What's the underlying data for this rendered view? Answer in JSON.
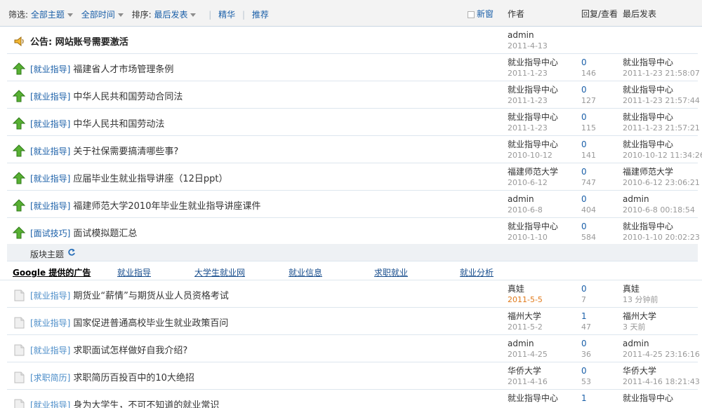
{
  "filters": {
    "filter_label": "筛选:",
    "all_topics": "全部主题",
    "all_time": "全部时间",
    "sort_label": "排序:",
    "sort_value": "最后发表",
    "digest": "精华",
    "recommend": "推荐",
    "new_window": "新窗"
  },
  "columns": {
    "author": "作者",
    "replies_views": "回复/查看",
    "last_post": "最后发表"
  },
  "announcement": {
    "title": "公告: 网站账号需要激活",
    "author": "admin",
    "date": "2011-4-13"
  },
  "sticky_rows": [
    {
      "cat": "[就业指导]",
      "subject": "福建省人才市场管理条例",
      "author": "就业指导中心",
      "date": "2011-1-23",
      "replies": "0",
      "views": "146",
      "last_user": "就业指导中心",
      "last_time": "2011-1-23 21:58:07"
    },
    {
      "cat": "[就业指导]",
      "subject": "中华人民共和国劳动合同法",
      "author": "就业指导中心",
      "date": "2011-1-23",
      "replies": "0",
      "views": "127",
      "last_user": "就业指导中心",
      "last_time": "2011-1-23 21:57:44"
    },
    {
      "cat": "[就业指导]",
      "subject": "中华人民共和国劳动法",
      "author": "就业指导中心",
      "date": "2011-1-23",
      "replies": "0",
      "views": "115",
      "last_user": "就业指导中心",
      "last_time": "2011-1-23 21:57:21"
    },
    {
      "cat": "[就业指导]",
      "subject": "关于社保需要搞清哪些事?",
      "author": "就业指导中心",
      "date": "2010-10-12",
      "replies": "0",
      "views": "141",
      "last_user": "就业指导中心",
      "last_time": "2010-10-12 11:34:26"
    },
    {
      "cat": "[就业指导]",
      "subject": "应届毕业生就业指导讲座（12日ppt）",
      "author": "福建师范大学",
      "date": "2010-6-12",
      "replies": "0",
      "views": "747",
      "last_user": "福建师范大学",
      "last_time": "2010-6-12 23:06:21"
    },
    {
      "cat": "[就业指导]",
      "subject": "福建师范大学2010年毕业生就业指导讲座课件",
      "author": "admin",
      "date": "2010-6-8",
      "replies": "0",
      "views": "404",
      "last_user": "admin",
      "last_time": "2010-6-8 00:18:54"
    },
    {
      "cat": "[面试技巧]",
      "subject": "面试模拟题汇总",
      "author": "就业指导中心",
      "date": "2010-1-10",
      "replies": "0",
      "views": "584",
      "last_user": "就业指导中心",
      "last_time": "2010-1-10 20:02:23"
    }
  ],
  "section": {
    "label": "版块主题"
  },
  "ads": {
    "google": "Google 提供的广告",
    "links": [
      "就业指导",
      "大学生就业网",
      "就业信息",
      "求职就业",
      "就业分析"
    ]
  },
  "normal_rows": [
    {
      "cat": "[就业指导]",
      "subject": "期货业“薪情”与期货从业人员资格考试",
      "author": "真娃",
      "date": "2011-5-5",
      "replies": "0",
      "views": "7",
      "last_user": "真娃",
      "last_time": "13 分钟前",
      "hot": true
    },
    {
      "cat": "[就业指导]",
      "subject": "国家促进普通高校毕业生就业政策百问",
      "author": "福州大学",
      "date": "2011-5-2",
      "replies": "1",
      "views": "47",
      "last_user": "福州大学",
      "last_time": "3 天前"
    },
    {
      "cat": "[就业指导]",
      "subject": "求职面试怎样做好自我介绍?",
      "author": "admin",
      "date": "2011-4-25",
      "replies": "0",
      "views": "36",
      "last_user": "admin",
      "last_time": "2011-4-25 23:16:16"
    },
    {
      "cat": "[求职简历]",
      "subject": "求职简历百投百中的10大绝招",
      "author": "华侨大学",
      "date": "2011-4-16",
      "replies": "0",
      "views": "53",
      "last_user": "华侨大学",
      "last_time": "2011-4-16 18:21:43"
    },
    {
      "cat": "[就业指导]",
      "subject": "身为大学生，不可不知道的就业常识",
      "author": "就业指导中心",
      "date": "",
      "replies": "1",
      "views": "",
      "last_user": "就业指导中心",
      "last_time": ""
    }
  ]
}
